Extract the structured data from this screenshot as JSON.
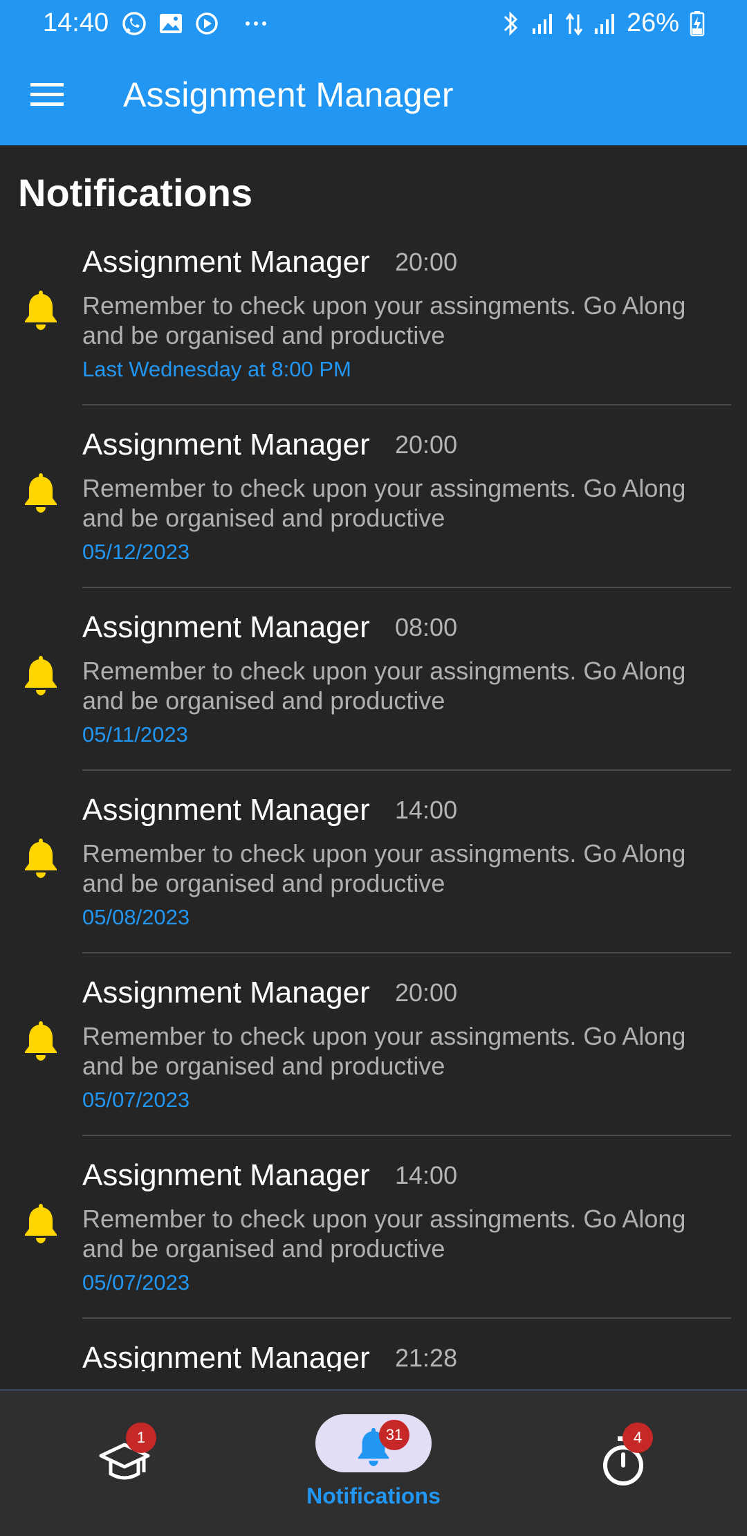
{
  "status_bar": {
    "time": "14:40",
    "battery": "26%",
    "left_icons": [
      "whatsapp-icon",
      "gallery-icon",
      "play-icon",
      "more-dots-icon"
    ],
    "right_icons": [
      "bluetooth-icon",
      "signal-icon",
      "data-arrows-icon",
      "signal-icon",
      "battery-charging-icon"
    ]
  },
  "app_bar": {
    "title": "Assignment Manager",
    "menu_icon": "hamburger-menu-icon"
  },
  "page": {
    "title": "Notifications"
  },
  "notifications": [
    {
      "title": "Assignment Manager",
      "time": "20:00",
      "body": "Remember to check upon your assingments. Go Along and be organised and productive",
      "date": "Last Wednesday at 8:00 PM"
    },
    {
      "title": "Assignment Manager",
      "time": "20:00",
      "body": "Remember to check upon your assingments. Go Along and be organised and productive",
      "date": "05/12/2023"
    },
    {
      "title": "Assignment Manager",
      "time": "08:00",
      "body": "Remember to check upon your assingments. Go Along and be organised and productive",
      "date": "05/11/2023"
    },
    {
      "title": "Assignment Manager",
      "time": "14:00",
      "body": "Remember to check upon your assingments. Go Along and be organised and productive",
      "date": "05/08/2023"
    },
    {
      "title": "Assignment Manager",
      "time": "20:00",
      "body": "Remember to check upon your assingments. Go Along and be organised and productive",
      "date": "05/07/2023"
    },
    {
      "title": "Assignment Manager",
      "time": "14:00",
      "body": "Remember to check upon your assingments. Go Along and be organised and productive",
      "date": "05/07/2023"
    },
    {
      "title": "Assignment Manager",
      "time": "21:28"
    }
  ],
  "bottom_nav": {
    "items": [
      {
        "icon": "graduation-cap-icon",
        "badge": "1",
        "label": ""
      },
      {
        "icon": "bell-icon",
        "badge": "31",
        "label": "Notifications",
        "selected": true
      },
      {
        "icon": "timer-icon",
        "badge": "4",
        "label": ""
      }
    ]
  },
  "colors": {
    "app_bar": "#2196f3",
    "background": "#252525",
    "bell": "#ffd600",
    "date_text": "#2196f3",
    "badge": "#c62828",
    "nav_pill": "#e3def5"
  }
}
